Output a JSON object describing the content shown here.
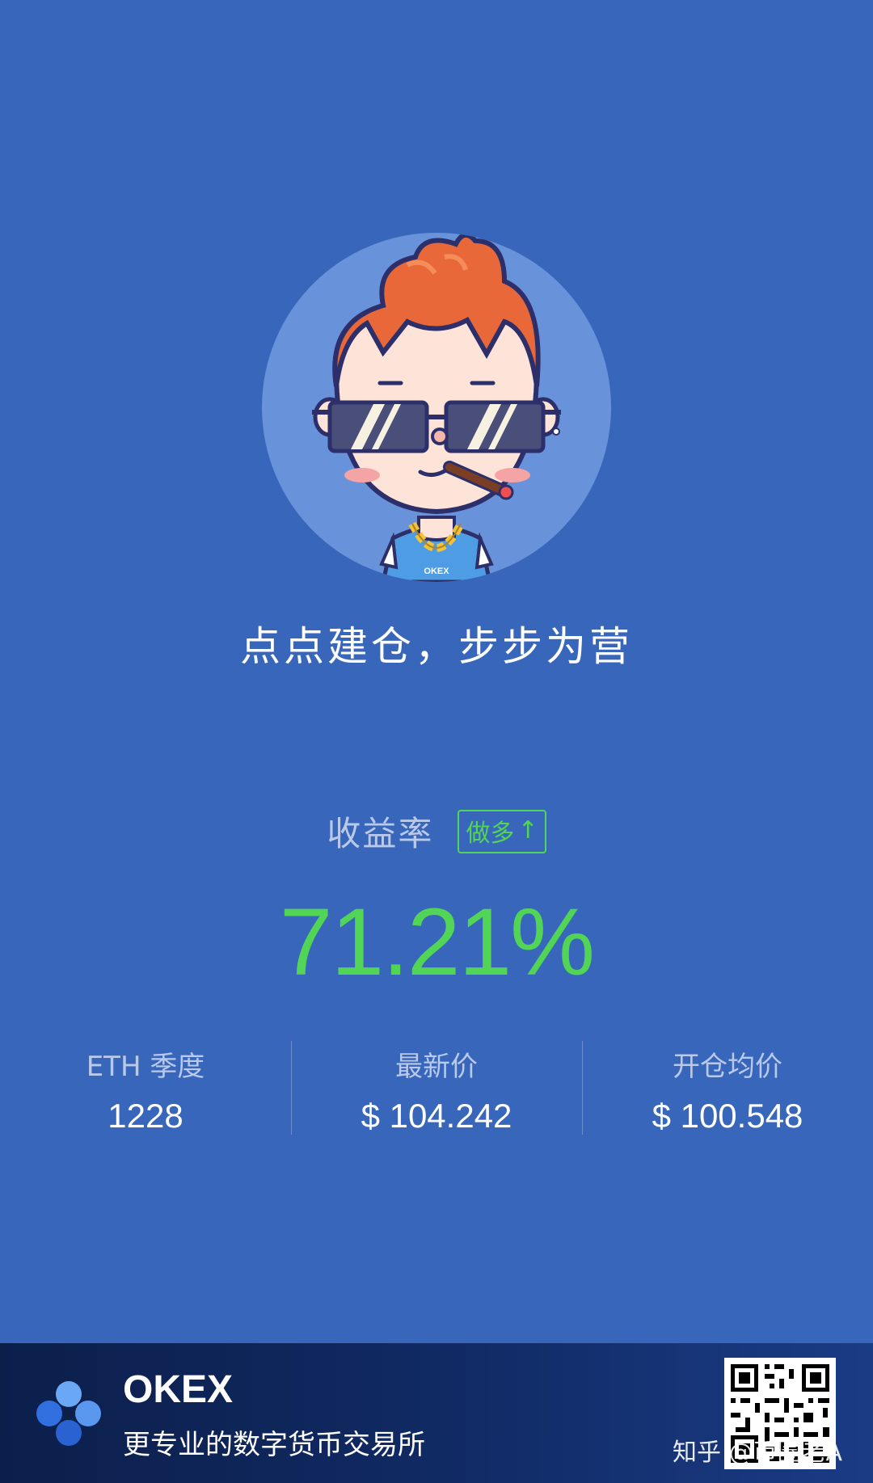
{
  "slogan": "点点建仓，步步为营",
  "yield": {
    "label": "收益率",
    "position_badge": "做多",
    "position_icon": "up-arrow-icon",
    "rate": "71.21%"
  },
  "stats": [
    {
      "label": "ETH 季度",
      "value": "1228"
    },
    {
      "label": "最新价",
      "value": "$ 104.242"
    },
    {
      "label": "开仓均价",
      "value": "$ 100.548"
    }
  ],
  "avatar": {
    "shirt_text": "OKEX"
  },
  "footer": {
    "brand": "OKEX",
    "tagline": "更专业的数字货币交易所",
    "watermark": "知乎 @币圈老A"
  },
  "colors": {
    "background": "#3766ba",
    "profit_green": "#52d457",
    "footer_dark": "#0c1f4b"
  }
}
